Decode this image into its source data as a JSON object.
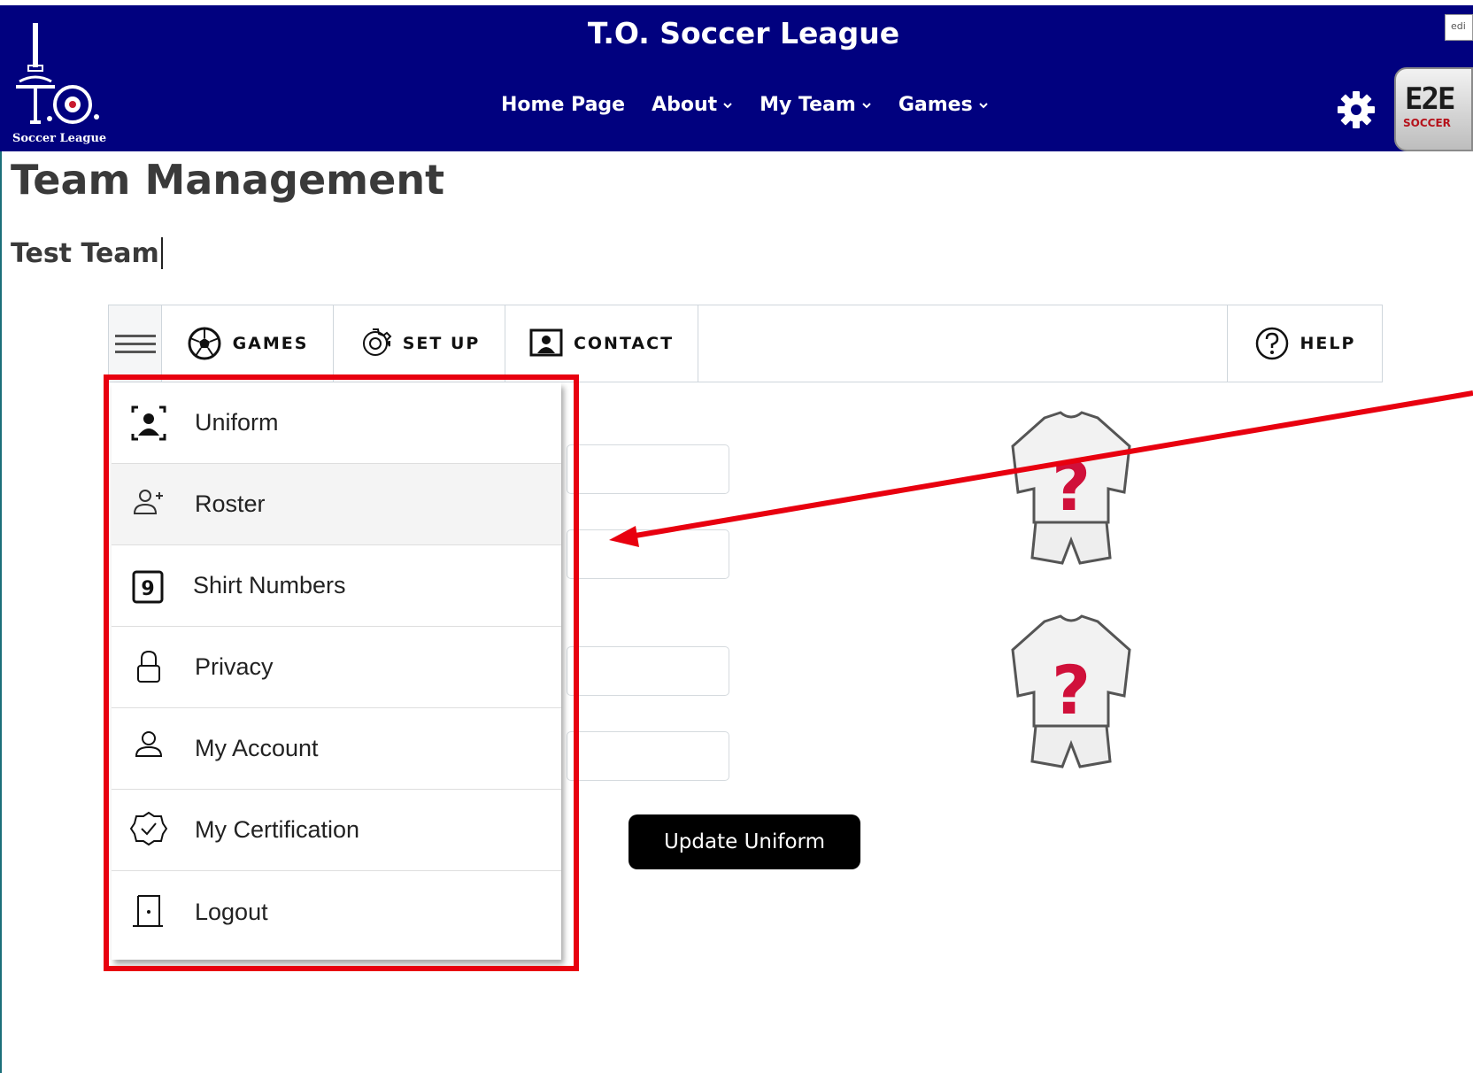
{
  "header": {
    "site_title": "T.O. Soccer League",
    "logo_text": "Soccer League",
    "nav": [
      {
        "label": "Home Page",
        "has_dropdown": false
      },
      {
        "label": "About",
        "has_dropdown": true
      },
      {
        "label": "My Team",
        "has_dropdown": true
      },
      {
        "label": "Games",
        "has_dropdown": true
      }
    ],
    "settings_icon": "gear-icon",
    "brand_logo": {
      "text": "E2E",
      "sub": "SOCCER"
    },
    "edit_label": "edi"
  },
  "page": {
    "title": "Team Management",
    "team_name": "Test Team"
  },
  "toolbar": {
    "menu_icon": "hamburger-icon",
    "tabs": [
      {
        "label": "GAMES",
        "icon": "soccer-ball-icon"
      },
      {
        "label": "SET UP",
        "icon": "gear-outline-icon"
      },
      {
        "label": "CONTACT",
        "icon": "contact-card-icon"
      },
      {
        "label": "HELP",
        "icon": "help-circle-icon"
      }
    ]
  },
  "menu": {
    "items": [
      {
        "label": "Uniform",
        "icon": "uniform-icon"
      },
      {
        "label": "Roster",
        "icon": "add-user-icon"
      },
      {
        "label": "Shirt Numbers",
        "icon": "shirt-number-icon",
        "badge": "9"
      },
      {
        "label": "Privacy",
        "icon": "lock-icon"
      },
      {
        "label": "My Account",
        "icon": "user-icon"
      },
      {
        "label": "My Certification",
        "icon": "certification-badge-icon"
      },
      {
        "label": "Logout",
        "icon": "door-icon"
      }
    ],
    "hovered_item": "Roster"
  },
  "form": {
    "update_button": "Update Uniform",
    "jersey_placeholder": "?"
  },
  "colors": {
    "header_bg": "#01017f",
    "annotation_red": "#e8000f",
    "question_mark": "#d0103a"
  }
}
